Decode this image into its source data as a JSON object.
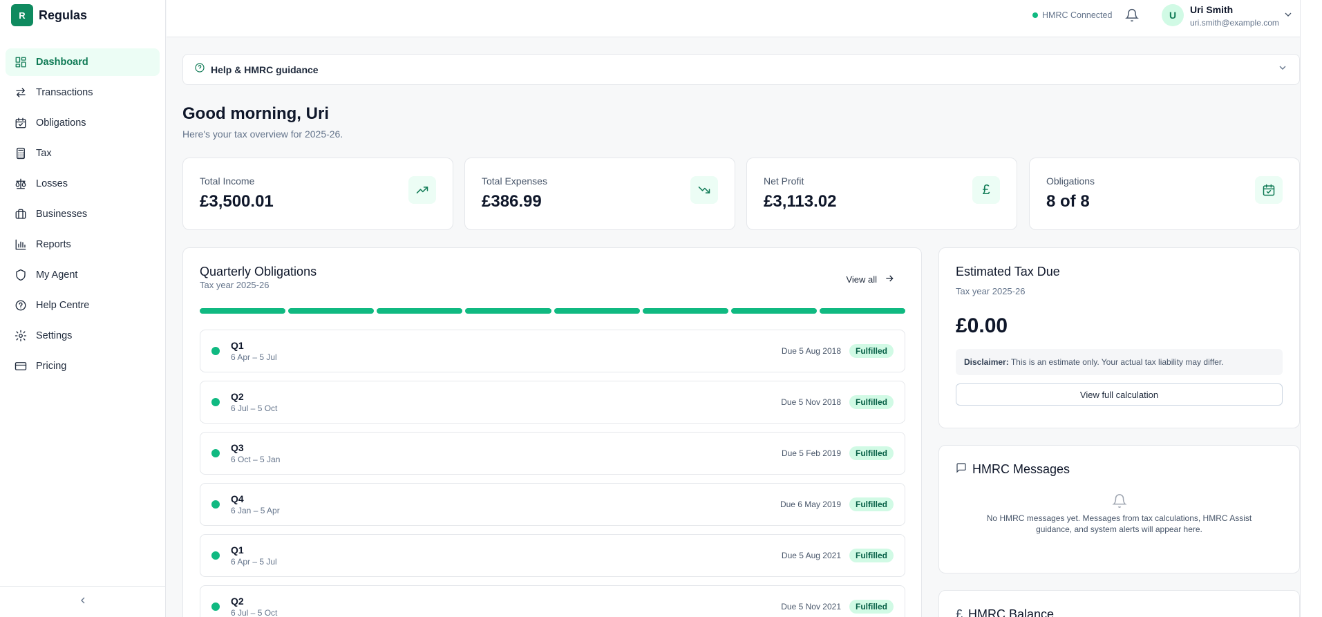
{
  "brand": {
    "logo_letter": "R",
    "name": "Regulas"
  },
  "sidebar": {
    "items": [
      {
        "label": "Dashboard",
        "icon": "dashboard-icon",
        "active": true
      },
      {
        "label": "Transactions",
        "icon": "arrows-swap-icon"
      },
      {
        "label": "Obligations",
        "icon": "calendar-check-icon"
      },
      {
        "label": "Tax",
        "icon": "calculator-icon"
      },
      {
        "label": "Losses",
        "icon": "scale-icon"
      },
      {
        "label": "Businesses",
        "icon": "briefcase-icon"
      },
      {
        "label": "Reports",
        "icon": "bar-chart-icon"
      },
      {
        "label": "My Agent",
        "icon": "shield-icon"
      },
      {
        "label": "Help Centre",
        "icon": "help-circle-icon"
      },
      {
        "label": "Settings",
        "icon": "gear-icon"
      },
      {
        "label": "Pricing",
        "icon": "credit-card-icon"
      }
    ],
    "collapse_icon": "chevron-left-icon"
  },
  "header": {
    "hmrc_status": "HMRC Connected",
    "user": {
      "initial": "U",
      "name": "Uri Smith",
      "email": "uri.smith@example.com"
    }
  },
  "help_bar": {
    "label": "Help & HMRC guidance"
  },
  "greeting": {
    "title": "Good morning, Uri",
    "subtitle": "Here's your tax overview for 2025-26."
  },
  "stats": [
    {
      "label": "Total Income",
      "value": "£3,500.01",
      "icon": "trending-up-icon"
    },
    {
      "label": "Total Expenses",
      "value": "£386.99",
      "icon": "trending-down-icon"
    },
    {
      "label": "Net Profit",
      "value": "£3,113.02",
      "icon": "pound-icon"
    },
    {
      "label": "Obligations",
      "value": "8 of 8",
      "icon": "calendar-check-icon"
    }
  ],
  "obligations": {
    "title": "Quarterly Obligations",
    "subtitle": "Tax year 2025-26",
    "view_all": "View all",
    "progress_done": 8,
    "progress_total": 8,
    "rows": [
      {
        "quarter": "Q1",
        "range": "6 Apr – 5 Jul",
        "due": "Due 5 Aug 2018",
        "status": "Fulfilled"
      },
      {
        "quarter": "Q2",
        "range": "6 Jul – 5 Oct",
        "due": "Due 5 Nov 2018",
        "status": "Fulfilled"
      },
      {
        "quarter": "Q3",
        "range": "6 Oct – 5 Jan",
        "due": "Due 5 Feb 2019",
        "status": "Fulfilled"
      },
      {
        "quarter": "Q4",
        "range": "6 Jan – 5 Apr",
        "due": "Due 6 May 2019",
        "status": "Fulfilled"
      },
      {
        "quarter": "Q1",
        "range": "6 Apr – 5 Jul",
        "due": "Due 5 Aug 2021",
        "status": "Fulfilled"
      },
      {
        "quarter": "Q2",
        "range": "6 Jul – 5 Oct",
        "due": "Due 5 Nov 2021",
        "status": "Fulfilled"
      }
    ]
  },
  "tax_due": {
    "title": "Estimated Tax Due",
    "subtitle": "Tax year 2025-26",
    "amount": "£0.00",
    "disclaimer_label": "Disclaimer:",
    "disclaimer_text": " This is an estimate only. Your actual tax liability may differ.",
    "button": "View full calculation"
  },
  "messages": {
    "title": "HMRC Messages",
    "empty_text": "No HMRC messages yet. Messages from tax calculations, HMRC Assist guidance, and system alerts will appear here."
  },
  "balance": {
    "title": "HMRC Balance",
    "icon_glyph": "£"
  },
  "colors": {
    "accent": "#10b981",
    "accent_dark": "#0f7a55",
    "badge_bg": "#d1fae5"
  }
}
